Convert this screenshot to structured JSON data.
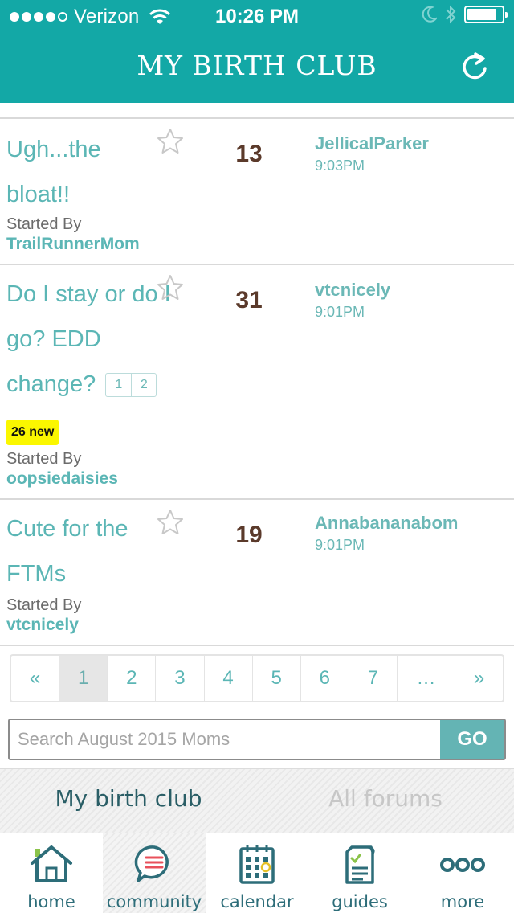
{
  "status_bar": {
    "carrier": "Verizon",
    "time": "10:26 PM",
    "battery_level": 0.8
  },
  "header": {
    "title": "MY BIRTH CLUB",
    "refresh_icon": "refresh-icon"
  },
  "threads": [
    {
      "title": "Ugh...the bloat!!",
      "replies": "13",
      "last_user": "JellicalParker",
      "last_time": "9:03PM",
      "started_label": "Started By",
      "starter": "TrailRunnerMom"
    },
    {
      "title": "Do I stay or do I go? EDD change?",
      "pages": [
        "1",
        "2"
      ],
      "new_count": "26 new",
      "replies": "31",
      "last_user": "vtcnicely",
      "last_time": "9:01PM",
      "started_label": "Started By",
      "starter": "oopsiedaisies"
    },
    {
      "title": "Cute for the FTMs",
      "replies": "19",
      "last_user": "Annabananabom",
      "last_time": "9:01PM",
      "started_label": "Started By",
      "starter": "vtcnicely"
    }
  ],
  "pagination": {
    "prev": "«",
    "pages": [
      "1",
      "2",
      "3",
      "4",
      "5",
      "6",
      "7"
    ],
    "current": "1",
    "ellipsis": "…",
    "next": "»"
  },
  "search": {
    "placeholder": "Search August 2015 Moms",
    "value": "",
    "go_label": "GO"
  },
  "tabs": {
    "my_birth_club": "My birth club",
    "all_forums": "All forums",
    "active": "my_birth_club"
  },
  "bottom_nav": [
    {
      "label": "home",
      "icon": "home-icon"
    },
    {
      "label": "community",
      "icon": "community-icon",
      "active": true
    },
    {
      "label": "calendar",
      "icon": "calendar-icon"
    },
    {
      "label": "guides",
      "icon": "guides-icon"
    },
    {
      "label": "more",
      "icon": "more-icon"
    }
  ],
  "colors": {
    "brand": "#13a8a6",
    "link": "#5bb6b5",
    "count": "#5b3a2b",
    "badge": "#fbf700"
  }
}
